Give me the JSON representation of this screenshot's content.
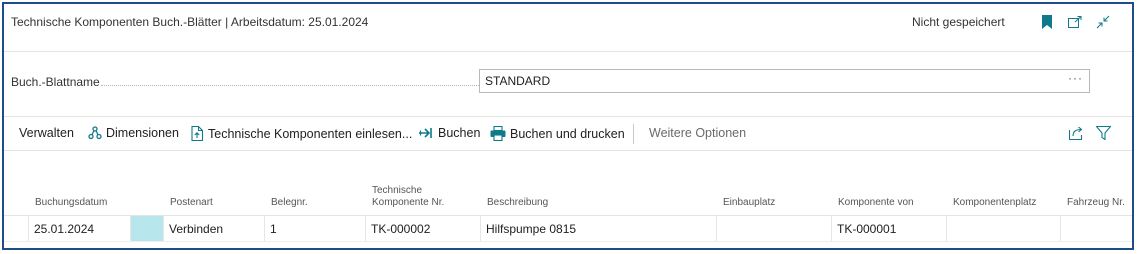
{
  "header": {
    "title": "Technische Komponenten Buch.-Blätter | Arbeitsdatum: 25.01.2024",
    "status": "Nicht gespeichert"
  },
  "field": {
    "label": "Buch.-Blattname",
    "value": "STANDARD",
    "more": "···"
  },
  "actions": {
    "manage": "Verwalten",
    "dimensions": "Dimensionen",
    "import": "Technische Komponenten einlesen...",
    "post": "Buchen",
    "post_print": "Buchen und drucken",
    "more_options": "Weitere Optionen"
  },
  "table": {
    "columns": {
      "posting_date": "Buchungsdatum",
      "entry_type": "Postenart",
      "doc_no": "Belegnr.",
      "component_no_1": "Technische",
      "component_no_2": "Komponente Nr.",
      "description": "Beschreibung",
      "install_location": "Einbauplatz",
      "component_of": "Komponente von",
      "component_location": "Komponentenplatz",
      "vehicle_no": "Fahrzeug Nr."
    },
    "rows": [
      {
        "posting_date": "25.01.2024",
        "entry_type": "Verbinden",
        "doc_no": "1",
        "component_no": "TK-000002",
        "description": "Hilfspumpe 0815",
        "install_location": "",
        "component_of": "TK-000001",
        "component_location": "",
        "vehicle_no": ""
      }
    ]
  },
  "colors": {
    "accent": "#0f7a8a",
    "frame": "#1f4d8a",
    "row_marker": "#b7e6ec"
  }
}
